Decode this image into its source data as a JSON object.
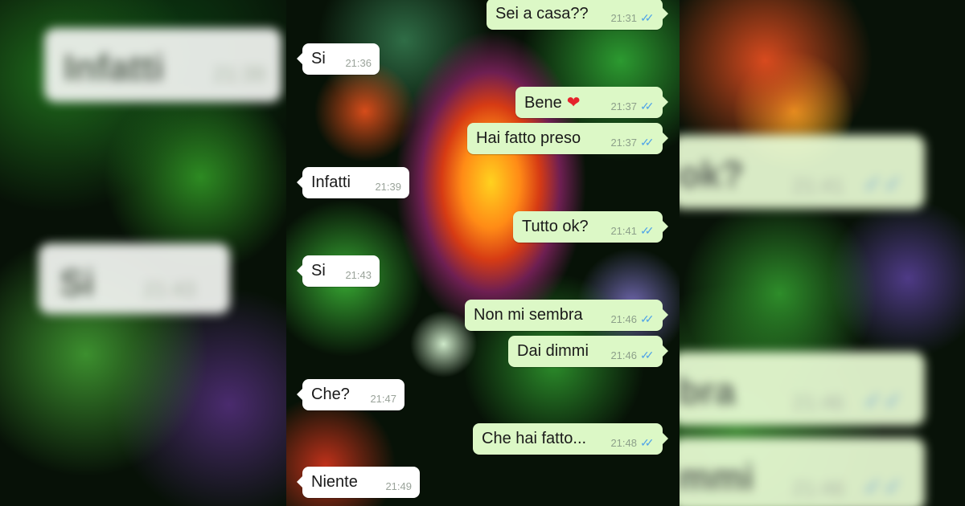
{
  "colors": {
    "incoming_bubble": "#ffffff",
    "outgoing_bubble": "#dcf8c6",
    "read_ticks": "#4fa3e8",
    "heart": "#e5222b"
  },
  "messages": [
    {
      "direction": "outgoing",
      "text": "Sei a casa??",
      "time": "21:31",
      "ticks": "✓✓"
    },
    {
      "direction": "incoming",
      "text": "Si",
      "time": "21:36"
    },
    {
      "direction": "outgoing",
      "text": "Bene",
      "emoji": "❤",
      "time": "21:37",
      "ticks": "✓✓"
    },
    {
      "direction": "outgoing",
      "text": "Hai fatto preso",
      "time": "21:37",
      "ticks": "✓✓"
    },
    {
      "direction": "incoming",
      "text": "Infatti",
      "time": "21:39"
    },
    {
      "direction": "outgoing",
      "text": "Tutto ok?",
      "time": "21:41",
      "ticks": "✓✓"
    },
    {
      "direction": "incoming",
      "text": "Si",
      "time": "21:43"
    },
    {
      "direction": "outgoing",
      "text": "Non mi sembra",
      "time": "21:46",
      "ticks": "✓✓"
    },
    {
      "direction": "outgoing",
      "text": "Dai dimmi",
      "time": "21:46",
      "ticks": "✓✓"
    },
    {
      "direction": "incoming",
      "text": "Che?",
      "time": "21:47"
    },
    {
      "direction": "outgoing",
      "text": "Che hai fatto...",
      "time": "21:48",
      "ticks": "✓✓"
    },
    {
      "direction": "incoming",
      "text": "Niente",
      "time": "21:49"
    }
  ],
  "background_zoom": {
    "left": [
      {
        "text": "Infatti",
        "time": "21:39"
      },
      {
        "text": "Si",
        "time": "21:43"
      }
    ],
    "right": [
      {
        "text": "ok?",
        "time": "21:41",
        "ticks": "✓✓"
      },
      {
        "text": "bra",
        "time": "21:46",
        "ticks": "✓✓"
      },
      {
        "text": "mmi",
        "time": "21:46",
        "ticks": "✓✓"
      }
    ]
  }
}
